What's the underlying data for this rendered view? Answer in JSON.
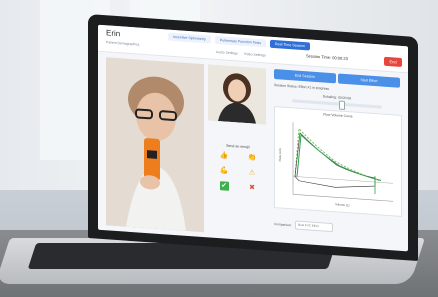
{
  "app": {
    "title": "Erin",
    "patient_demographics": "Patient Demographics"
  },
  "tabs": [
    {
      "label": "Incentive Spirometry"
    },
    {
      "label": "Pulmonary Function Tests"
    },
    {
      "label": "Real Time Session",
      "active": true
    }
  ],
  "settings": {
    "audio": "Audio Settings",
    "video": "Video Settings"
  },
  "session": {
    "timer": "Session Time: 00:00:23",
    "end_label": "End"
  },
  "controls": {
    "first": "End Session",
    "second": "Start Effort"
  },
  "status": {
    "line": "Session Status: Effort #1 in progress"
  },
  "exhale": {
    "label": "Exhaling: 00:00:08",
    "level": 0.55
  },
  "graph": {
    "title": "Flow Volume Curve",
    "ylabel": "Flow (L/s)",
    "xlabel": "Volume (L)"
  },
  "compare": {
    "label": "Comparison:",
    "value": "Best FVC Effort"
  },
  "send": {
    "label": "Send an emoji!"
  },
  "emojis": [
    "thumbs-up",
    "clap",
    "muscle",
    "warning",
    "check",
    "cross"
  ],
  "device": {
    "brand": "MacBook Pro"
  }
}
